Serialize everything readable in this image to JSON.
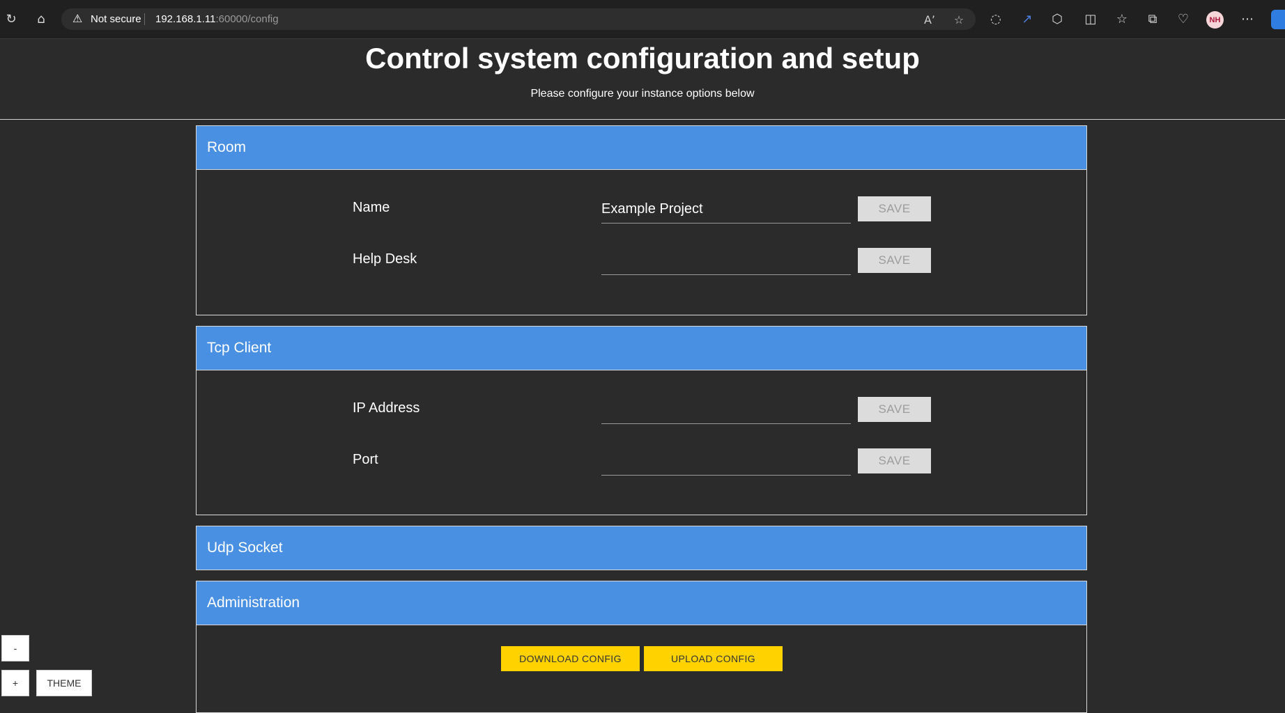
{
  "browser": {
    "security_label": "Not secure",
    "url_host": "192.168.1.11",
    "url_rest": ":60000/config",
    "profile_initials": "NH",
    "icons": [
      "refresh-icon",
      "home-icon",
      "warning-icon",
      "read-aloud-icon",
      "favorite-star-icon",
      "extension-icon",
      "split-screen-icon",
      "favorites-icon",
      "collections-icon",
      "performance-icon",
      "more-icon"
    ]
  },
  "header": {
    "title": "Control system configuration and setup",
    "subtitle": "Please configure your instance options below"
  },
  "panels": {
    "room": {
      "title": "Room",
      "fields": [
        {
          "label": "Name",
          "value": "Example Project",
          "save_label": "SAVE"
        },
        {
          "label": "Help Desk",
          "value": "",
          "save_label": "SAVE"
        }
      ]
    },
    "tcp": {
      "title": "Tcp Client",
      "fields": [
        {
          "label": "IP Address",
          "value": "",
          "save_label": "SAVE"
        },
        {
          "label": "Port",
          "value": "",
          "save_label": "SAVE"
        }
      ]
    },
    "udp": {
      "title": "Udp Socket"
    },
    "admin": {
      "title": "Administration",
      "download_label": "DOWNLOAD CONFIG",
      "upload_label": "UPLOAD CONFIG"
    }
  },
  "controls": {
    "zoom_out_label": "-",
    "zoom_in_label": "+",
    "theme_label": "THEME"
  },
  "colors": {
    "background": "#2b2b2b",
    "panel_header": "#4a90e2",
    "admin_button": "#ffd200",
    "save_button": "#dcdcdc"
  }
}
